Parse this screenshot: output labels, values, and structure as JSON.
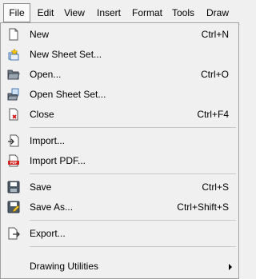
{
  "menubar": {
    "items": [
      {
        "label": "File"
      },
      {
        "label": "Edit"
      },
      {
        "label": "View"
      },
      {
        "label": "Insert"
      },
      {
        "label": "Format"
      },
      {
        "label": "Tools"
      },
      {
        "label": "Draw"
      }
    ]
  },
  "file_menu": {
    "new": {
      "label": "New",
      "shortcut": "Ctrl+N",
      "icon": "new-document-icon"
    },
    "new_sheet_set": {
      "label": "New Sheet Set...",
      "icon": "new-sheet-set-icon"
    },
    "open": {
      "label": "Open...",
      "shortcut": "Ctrl+O",
      "icon": "open-folder-icon"
    },
    "open_sheet_set": {
      "label": "Open Sheet Set...",
      "icon": "open-sheet-set-icon"
    },
    "close": {
      "label": "Close",
      "shortcut": "Ctrl+F4",
      "icon": "close-document-icon"
    },
    "import": {
      "label": "Import...",
      "icon": "import-icon"
    },
    "import_pdf": {
      "label": "Import PDF...",
      "icon": "pdf-icon"
    },
    "save": {
      "label": "Save",
      "shortcut": "Ctrl+S",
      "icon": "save-icon"
    },
    "save_as": {
      "label": "Save As...",
      "shortcut": "Ctrl+Shift+S",
      "icon": "save-as-icon"
    },
    "export": {
      "label": "Export...",
      "icon": "export-icon"
    },
    "drawing_utilities": {
      "label": "Drawing Utilities",
      "icon": "submenu-arrow-icon"
    }
  }
}
